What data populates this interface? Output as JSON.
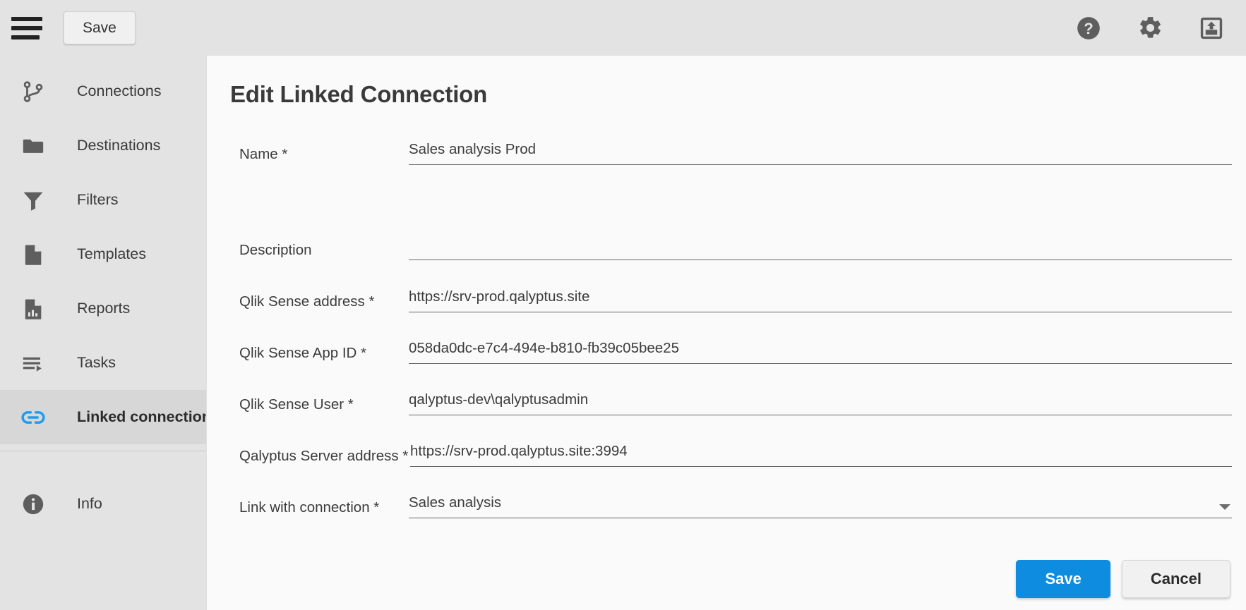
{
  "topbar": {
    "menu_icon": "hamburger-menu-icon",
    "save_label": "Save",
    "icons": [
      {
        "name": "help-icon",
        "title": "Help"
      },
      {
        "name": "settings-gear-icon",
        "title": "Settings"
      },
      {
        "name": "export-upload-icon",
        "title": "Export"
      }
    ]
  },
  "sidebar": {
    "items": [
      {
        "label": "Connections",
        "icon": "branch-icon",
        "active": false
      },
      {
        "label": "Destinations",
        "icon": "folder-icon",
        "active": false
      },
      {
        "label": "Filters",
        "icon": "filter-funnel-icon",
        "active": false
      },
      {
        "label": "Templates",
        "icon": "document-icon",
        "active": false
      },
      {
        "label": "Reports",
        "icon": "report-chart-icon",
        "active": false
      },
      {
        "label": "Tasks",
        "icon": "tasks-play-icon",
        "active": false
      },
      {
        "label": "Linked connections",
        "icon": "link-chain-icon",
        "active": true
      }
    ],
    "footer_items": [
      {
        "label": "Info",
        "icon": "info-circle-icon",
        "active": false
      }
    ],
    "active_accent_color": "#1e9bef"
  },
  "main": {
    "title": "Edit Linked Connection",
    "fields": [
      {
        "label": "Name *",
        "value": "Sales analysis Prod",
        "type": "text"
      },
      {
        "label": "Description",
        "value": "",
        "type": "textarea"
      },
      {
        "label": "Qlik Sense address *",
        "value": "https://srv-prod.qalyptus.site",
        "type": "text"
      },
      {
        "label": "Qlik Sense App ID *",
        "value": "058da0dc-e7c4-494e-b810-fb39c05bee25",
        "type": "text"
      },
      {
        "label": "Qlik Sense User *",
        "value": "qalyptus-dev\\qalyptusadmin",
        "type": "text"
      },
      {
        "label": "Qalyptus Server address *",
        "value": "https://srv-prod.qalyptus.site:3994",
        "type": "text"
      },
      {
        "label": "Link with connection *",
        "value": "Sales analysis",
        "type": "select"
      }
    ],
    "buttons": {
      "save_label": "Save",
      "cancel_label": "Cancel",
      "save_color": "#0d8ce0"
    }
  }
}
